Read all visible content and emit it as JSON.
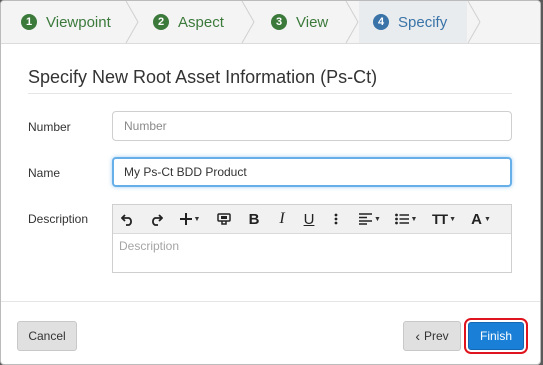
{
  "wizard": {
    "steps": [
      {
        "num": "1",
        "label": "Viewpoint",
        "state": "done"
      },
      {
        "num": "2",
        "label": "Aspect",
        "state": "done"
      },
      {
        "num": "3",
        "label": "View",
        "state": "done"
      },
      {
        "num": "4",
        "label": "Specify",
        "state": "active"
      }
    ]
  },
  "form": {
    "title": "Specify New Root Asset Information (Ps-Ct)",
    "number_label": "Number",
    "number_placeholder": "Number",
    "number_value": "",
    "name_label": "Name",
    "name_value": "My Ps-Ct BDD Product",
    "description_label": "Description",
    "description_placeholder": "Description"
  },
  "toolbar": {
    "icons": [
      "undo-icon",
      "redo-icon",
      "insert-icon",
      "style-icon",
      "bold-icon",
      "italic-icon",
      "underline-icon",
      "more-icon",
      "align-icon",
      "list-icon",
      "font-size-icon",
      "font-color-icon"
    ],
    "bold": "B",
    "italic": "I",
    "underline": "U",
    "font_size": "TT",
    "font_color": "A"
  },
  "footer": {
    "cancel_label": "Cancel",
    "prev_label": "Prev",
    "finish_label": "Finish"
  },
  "colors": {
    "step_done": "#3c7a3c",
    "step_active": "#3a73a8",
    "primary": "#1a7fd6",
    "highlight": "#e0141e",
    "focus": "#66afe9"
  }
}
